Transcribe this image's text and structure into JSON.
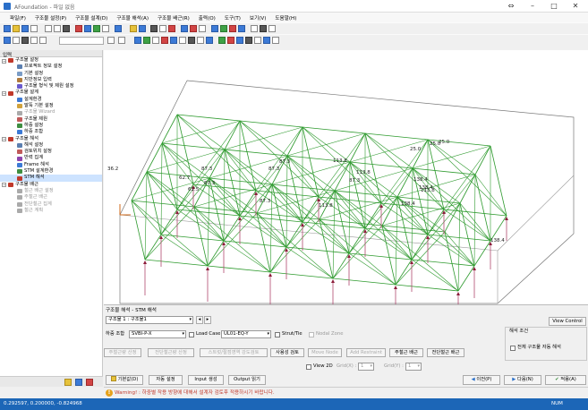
{
  "app": {
    "title": "AFoundation - 파일 없음"
  },
  "menu": [
    "파일(F)",
    "구조물 설정(P)",
    "구조물 설계(D)",
    "구조물 해석(A)",
    "구조물 배근(R)",
    "출력(O)",
    "도구(T)",
    "보기(V)",
    "도움말(H)"
  ],
  "sidebar": {
    "header": "입력",
    "items": [
      {
        "label": "구조물 설정",
        "level": 0,
        "expand": "−",
        "icon": "settings-icon",
        "color": "#c0392b"
      },
      {
        "label": "프로젝트 정보 설정",
        "level": 1,
        "icon": "project-info-icon",
        "color": "#5b7fb0"
      },
      {
        "label": "기본 설정",
        "level": 1,
        "icon": "basic-settings-icon",
        "color": "#7a9cc6"
      },
      {
        "label": "지반정보 입력",
        "level": 1,
        "icon": "ground-info-icon",
        "color": "#b07a3a"
      },
      {
        "label": "구조물 형식 및 제원 설정",
        "level": 1,
        "icon": "structure-type-icon",
        "color": "#6a5acd"
      },
      {
        "label": "구조물 설계",
        "level": 0,
        "expand": "−",
        "icon": "design-icon",
        "color": "#c0392b"
      },
      {
        "label": "설계환경",
        "level": 1,
        "icon": "design-env-icon",
        "color": "#3c7ad6"
      },
      {
        "label": "말뚝 기본 설정",
        "level": 1,
        "icon": "pile-settings-icon",
        "color": "#d1a23c"
      },
      {
        "label": "구조물 Wizard",
        "level": 1,
        "icon": "wizard-icon",
        "color": "#aaaaaa",
        "dim": true
      },
      {
        "label": "구조물 제원",
        "level": 1,
        "icon": "dimension-icon",
        "color": "#c05a5a"
      },
      {
        "label": "하중 설정",
        "level": 1,
        "icon": "load-settings-icon",
        "color": "#3e8e41"
      },
      {
        "label": "하중 조합",
        "level": 1,
        "icon": "load-combination-icon",
        "color": "#3c7ad6"
      },
      {
        "label": "구조물 해석",
        "level": 0,
        "expand": "−",
        "icon": "analysis-icon",
        "color": "#c0392b"
      },
      {
        "label": "해석 설정",
        "level": 1,
        "icon": "analysis-settings-icon",
        "color": "#5b7fb0"
      },
      {
        "label": "검토위치 설정",
        "level": 1,
        "icon": "check-position-icon",
        "color": "#c05a5a"
      },
      {
        "label": "반력 집계",
        "level": 1,
        "icon": "reaction-sum-icon",
        "color": "#8e44ad"
      },
      {
        "label": "Frame 해석",
        "level": 1,
        "icon": "frame-analysis-icon",
        "color": "#3c7ad6"
      },
      {
        "label": "STM 설계환경",
        "level": 1,
        "icon": "stm-env-icon",
        "color": "#3e8e41"
      },
      {
        "label": "STM 해석",
        "level": 1,
        "icon": "stm-analysis-icon",
        "color": "#c0392b",
        "selected": true
      },
      {
        "label": "구조물 배근",
        "level": 0,
        "expand": "−",
        "icon": "rebar-icon",
        "color": "#c0392b"
      },
      {
        "label": "철근 배근 설정",
        "level": 1,
        "icon": "rebar-settings-icon",
        "color": "#aaaaaa",
        "dim": true
      },
      {
        "label": "주철근 배근",
        "level": 1,
        "icon": "main-rebar-icon",
        "color": "#aaaaaa",
        "dim": true
      },
      {
        "label": "전단철근 집계",
        "level": 1,
        "icon": "shear-rebar-icon",
        "color": "#aaaaaa",
        "dim": true
      },
      {
        "label": "철근 계획",
        "level": 1,
        "icon": "rebar-plan-icon",
        "color": "#aaaaaa",
        "dim": true
      }
    ]
  },
  "viewport": {
    "labels": [
      "138.4",
      "138.4",
      "113.8",
      "113.8",
      "87.3",
      "87.3",
      "113.8",
      "62.5",
      "87.3",
      "87.3",
      "138.4",
      "87.3",
      "36.2",
      "113.8",
      "138.4",
      "25.0",
      "12.5",
      "11.8",
      "87.3",
      "16.7",
      "62.7",
      "25.0",
      "25.0"
    ]
  },
  "panel": {
    "title": "구조물 해석 - STM 해석",
    "structure_select": "구조물 1 : 구조물1",
    "load_combo_label": "하중 조합",
    "load_combo_value": "SVBI-P-X",
    "load_case_label": "Load Case",
    "load_case_value": "UL01-EQ-Y",
    "strut_tie_label": "Strut/Tie",
    "nodal_zone_label": "Nodal Zone",
    "view_control_label": "View Control",
    "analysis_cond_title": "해석 조건",
    "all_auto_label": "전체 구조물 자동 해석",
    "row_buttons": [
      "주철근량 산정",
      "전단철근량 산정",
      "스트럿/절점영역 강도검토",
      "사용성 검토",
      "Move Node",
      "Add Restraint",
      "주철근 배근",
      "전단철근 배근"
    ],
    "view2d_label": "View 2D",
    "grid_x_label": "Grid(X) :",
    "grid_x_value": "1",
    "grid_y_label": "Grid(Y) :",
    "grid_y_value": "1",
    "bottom_buttons": [
      "기본값(D)",
      "자동 설정",
      "Input 생성",
      "Output 읽기"
    ],
    "prev_label": "이전(P)",
    "next_label": "다음(N)",
    "apply_label": "적용(A)"
  },
  "warning": {
    "text": "Warning! : 하중별 작용 방향에 대해서 설계자 검토후 적용하시기 바랍니다."
  },
  "status": {
    "coords": "0.292597, 0.200000, -0.824968",
    "num": "NUM"
  }
}
